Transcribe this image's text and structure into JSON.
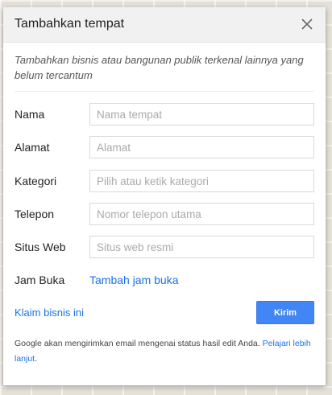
{
  "dialog": {
    "title": "Tambahkan tempat",
    "subtitle": "Tambahkan bisnis atau bangunan publik terkenal lainnya yang belum tercantum"
  },
  "form": {
    "name": {
      "label": "Nama",
      "placeholder": "Nama tempat",
      "value": ""
    },
    "address": {
      "label": "Alamat",
      "placeholder": "Alamat",
      "value": ""
    },
    "category": {
      "label": "Kategori",
      "placeholder": "Pilih atau ketik kategori",
      "value": ""
    },
    "phone": {
      "label": "Telepon",
      "placeholder": "Nomor telepon utama",
      "value": ""
    },
    "website": {
      "label": "Situs Web",
      "placeholder": "Situs web resmi",
      "value": ""
    },
    "hours": {
      "label": "Jam Buka",
      "link": "Tambah jam buka"
    }
  },
  "actions": {
    "claim_link": "Klaim bisnis ini",
    "submit_label": "Kirim"
  },
  "footer": {
    "text": "Google akan mengirimkan email mengenai status hasil edit Anda.",
    "learn_more": "Pelajari lebih lanjut",
    "period": "."
  },
  "icons": {
    "close": "close-icon"
  },
  "colors": {
    "accent": "#4285f4",
    "link": "#1a73e8",
    "header_bg": "#f1f1f1"
  }
}
